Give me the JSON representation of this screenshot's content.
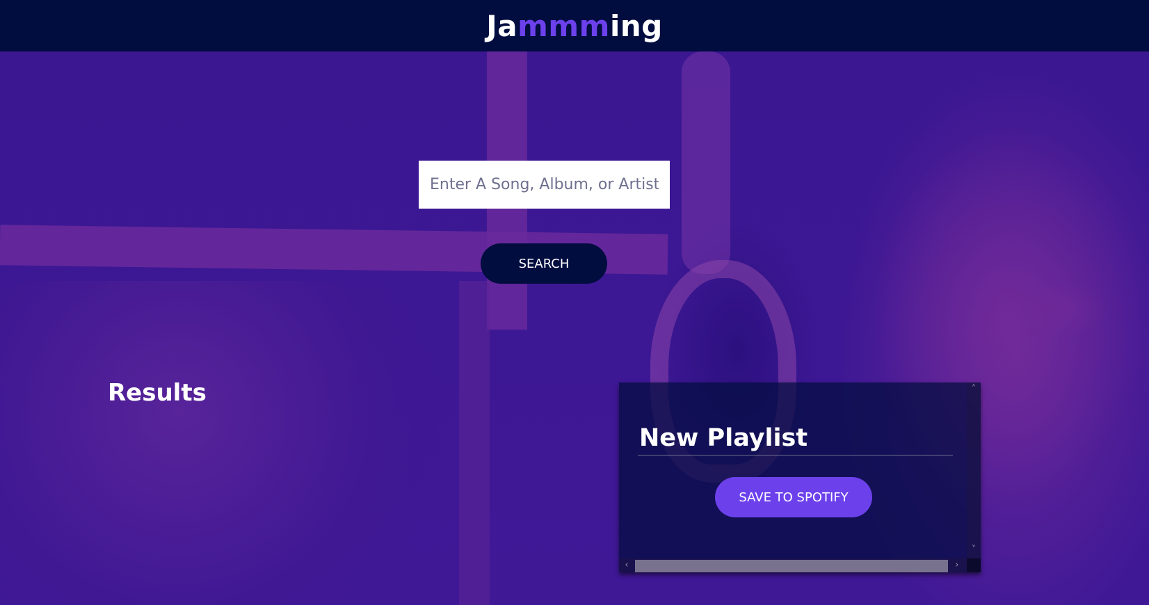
{
  "app": {
    "logo_prefix": "Ja",
    "logo_highlight": "mmm",
    "logo_suffix": "ing"
  },
  "search": {
    "placeholder": "Enter A Song, Album, or Artist",
    "value": "",
    "button_label": "SEARCH"
  },
  "results": {
    "title": "Results"
  },
  "playlist": {
    "name": "New Playlist",
    "save_label": "SAVE TO SPOTIFY"
  },
  "scrollbars": {
    "up_icon": "chevron-up-icon",
    "down_icon": "chevron-down-icon",
    "left_icon": "chevron-left-icon",
    "right_icon": "chevron-right-icon"
  },
  "colors": {
    "header_bg": "#010c3f",
    "accent": "#6c41ec",
    "page_bg": "#3d1793",
    "search_button_bg": "#010c3f",
    "text": "#ffffff"
  }
}
